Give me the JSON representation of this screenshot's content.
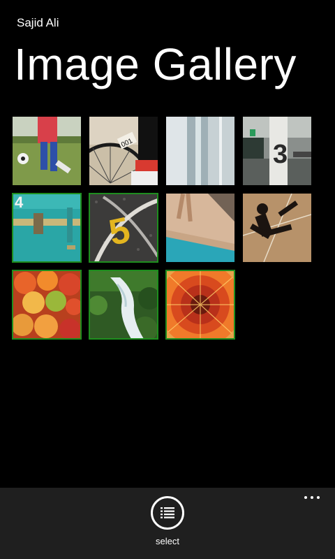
{
  "header": {
    "app_name": "Sajid Ali",
    "title": "Image Gallery"
  },
  "gallery": {
    "images": [
      {
        "name": "soccer-player-image",
        "selected": false
      },
      {
        "name": "bicycle-wheel-001-image",
        "selected": false
      },
      {
        "name": "glass-building-image",
        "selected": false
      },
      {
        "name": "pillar-number-3-image",
        "selected": false
      },
      {
        "name": "teal-door-4-image",
        "selected": true
      },
      {
        "name": "asphalt-number-5-image",
        "selected": true
      },
      {
        "name": "pool-edge-image",
        "selected": false
      },
      {
        "name": "shadow-jumper-image",
        "selected": false
      },
      {
        "name": "fruit-pile-image",
        "selected": true
      },
      {
        "name": "waterfall-stream-image",
        "selected": true
      },
      {
        "name": "flower-macro-image",
        "selected": true
      }
    ]
  },
  "app_bar": {
    "select_label": "select",
    "select_icon": "select-list-icon",
    "more_icon": "more-dots-icon"
  },
  "colors": {
    "background": "#000000",
    "app_bar": "#1f1f1f",
    "selection_border": "#1e8e1e"
  }
}
